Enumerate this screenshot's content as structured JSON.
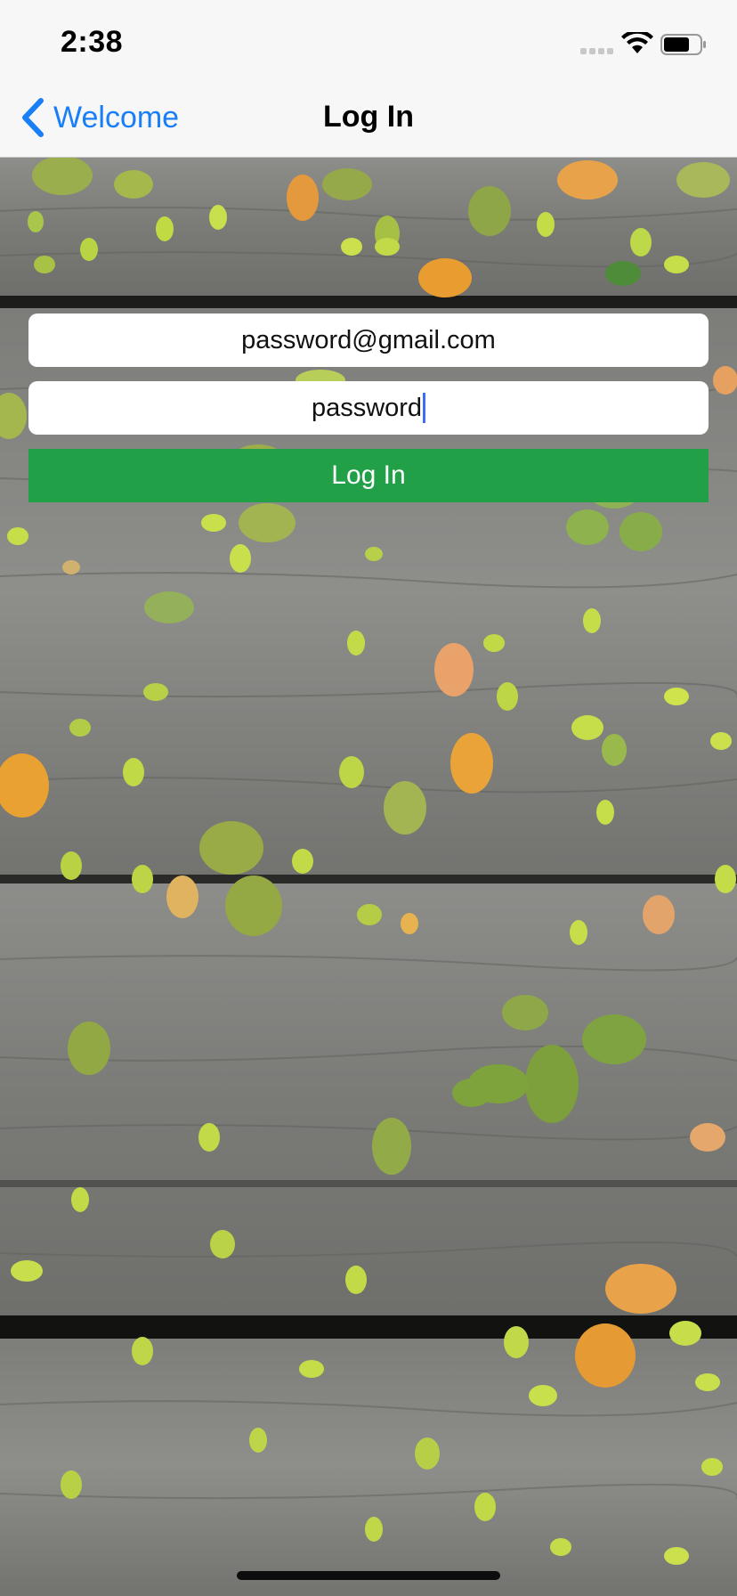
{
  "status_bar": {
    "time": "2:38",
    "icons": [
      "signal-icon",
      "wifi-icon",
      "battery-icon"
    ]
  },
  "nav": {
    "back_label": "Welcome",
    "back_icon": "chevron-left-icon",
    "title": "Log In"
  },
  "form": {
    "email_value": "password@gmail.com",
    "password_value": "password",
    "login_label": "Log In"
  },
  "colors": {
    "accent": "#1a7ff6",
    "login_button": "#21a047",
    "caret": "#3b6ff5"
  }
}
